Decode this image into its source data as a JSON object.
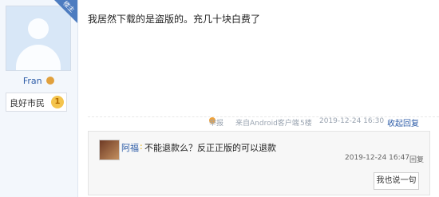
{
  "user_panel": {
    "ribbon": "楼主",
    "username": "Fran",
    "title": "良好市民",
    "level": "1"
  },
  "post": {
    "text": "我居然下载的是盗版的。充几十块白费了",
    "meta": {
      "report": "举报",
      "source": "来自Android客户端",
      "floor": "5楼",
      "time": "2019-12-24 16:30",
      "collapse_reply": "收起回复"
    }
  },
  "reply": {
    "user": "阿福",
    "colon": ":",
    "text": "不能退款么？反正正版的可以退款",
    "time": "2019-12-24 16:47",
    "action": "回复",
    "say_button": "我也说一句"
  },
  "colors": {
    "link_blue": "#2f5ea8",
    "panel_bg": "#f3f7fc",
    "ribbon_blue": "#4d7cc0"
  }
}
